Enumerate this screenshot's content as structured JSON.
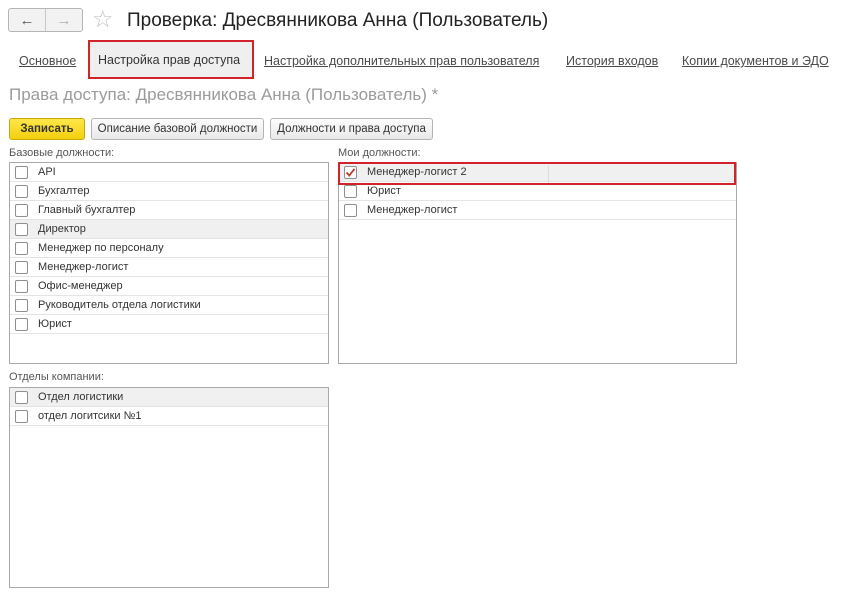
{
  "header": {
    "back_icon": "arrow-left-icon",
    "forward_icon": "arrow-right-icon",
    "favorite_icon": "star-icon",
    "title": "Проверка: Дресвянникова Анна (Пользователь)"
  },
  "tabs": [
    {
      "label": "Основное"
    },
    {
      "label": "Настройка прав доступа",
      "active": true
    },
    {
      "label": "Настройка дополнительных прав пользователя"
    },
    {
      "label": "История входов"
    },
    {
      "label": "Копии документов и ЭДО"
    }
  ],
  "subtitle": "Права доступа: Дресвянникова Анна (Пользователь) *",
  "toolbar": {
    "save_label": "Записать",
    "base_desc_label": "Описание базовой должности",
    "positions_rights_label": "Должности и права доступа"
  },
  "base_positions": {
    "label": "Базовые должности:",
    "items": [
      {
        "text": "API",
        "checked": false
      },
      {
        "text": "Бухгалтер",
        "checked": false
      },
      {
        "text": "Главный бухгалтер",
        "checked": false
      },
      {
        "text": "Директор",
        "checked": false,
        "selected": true
      },
      {
        "text": "Менеджер по персоналу",
        "checked": false
      },
      {
        "text": "Менеджер-логист",
        "checked": false
      },
      {
        "text": "Офис-менеджер",
        "checked": false
      },
      {
        "text": "Руководитель отдела логистики",
        "checked": false
      },
      {
        "text": "Юрист",
        "checked": false
      }
    ]
  },
  "my_positions": {
    "label": "Мои должности:",
    "items": [
      {
        "text": "Менеджер-логист 2",
        "checked": true,
        "selected": true
      },
      {
        "text": "Юрист",
        "checked": false
      },
      {
        "text": "Менеджер-логист",
        "checked": false
      }
    ]
  },
  "departments": {
    "label": "Отделы компании:",
    "items": [
      {
        "text": "Отдел логистики",
        "checked": false,
        "selected": true
      },
      {
        "text": "отдел логитсики №1",
        "checked": false
      }
    ]
  },
  "colors": {
    "accent_red": "#d2232a",
    "primary_button": "#f5d31a",
    "check_red": "#c0392b"
  }
}
